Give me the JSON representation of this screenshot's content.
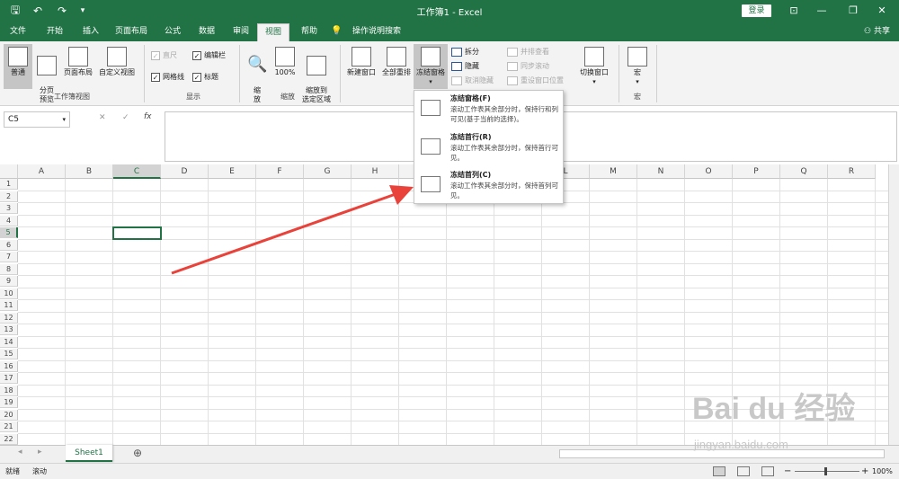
{
  "titlebar": {
    "title": "工作簿1  -  Excel",
    "login": "登录",
    "save_glyph": "🖫",
    "undo_glyph": "↶",
    "redo_glyph": "↷",
    "customize_glyph": "▾",
    "ribbon_display_glyph": "⊡",
    "minimize_glyph": "—",
    "restore_glyph": "❐",
    "close_glyph": "✕"
  },
  "tabs": [
    "文件",
    "开始",
    "插入",
    "页面布局",
    "公式",
    "数据",
    "审阅",
    "视图",
    "帮助",
    "操作说明搜索"
  ],
  "active_tab": "视图",
  "share_label": "共享",
  "ribbon": {
    "workbook_views": {
      "label": "工作簿视图",
      "normal": "普通",
      "page_break": "分页\n预览",
      "page_layout": "页面布局",
      "custom": "自定义视图"
    },
    "show": {
      "label": "显示",
      "ruler": "直尺",
      "formula_bar": "编辑栏",
      "gridlines": "网格线",
      "headings": "标题"
    },
    "zoom": {
      "label": "缩放",
      "zoom": "缩\n放",
      "hundred": "100%",
      "zoom_selection": "缩放到\n选定区域"
    },
    "window": {
      "new_window": "新建窗口",
      "arrange_all": "全部重排",
      "freeze_panes": "冻结窗格",
      "split": "拆分",
      "hide": "隐藏",
      "unhide": "取消隐藏",
      "view_side": "并排查看",
      "sync_scroll": "同步滚动",
      "reset_pos": "重设窗口位置",
      "switch": "切换窗口",
      "dropdown_glyph": "▾"
    },
    "macros": {
      "label": "宏",
      "macro": "宏"
    }
  },
  "formula_bar": {
    "name_box": "C5",
    "cancel_glyph": "✕",
    "enter_glyph": "✓",
    "fx_glyph": "fx",
    "dropdown_glyph": "▾",
    "value": ""
  },
  "grid": {
    "columns": [
      "A",
      "B",
      "C",
      "D",
      "E",
      "F",
      "G",
      "H",
      "I",
      "J",
      "K",
      "L",
      "M",
      "N",
      "O",
      "P",
      "Q",
      "R"
    ],
    "rows": [
      "1",
      "2",
      "3",
      "4",
      "5",
      "6",
      "7",
      "8",
      "9",
      "10",
      "11",
      "12",
      "13",
      "14",
      "15",
      "16",
      "17",
      "18",
      "19",
      "20",
      "21",
      "22"
    ],
    "selected_col": "C",
    "selected_row": "5"
  },
  "dropdown": {
    "items": [
      {
        "title": "冻结窗格(F)",
        "desc": "滚动工作表其余部分时，保持行和列可见(基于当前的选择)。"
      },
      {
        "title": "冻结首行(R)",
        "desc": "滚动工作表其余部分时，保持首行可见。"
      },
      {
        "title": "冻结首列(C)",
        "desc": "滚动工作表其余部分时，保持首列可见。"
      }
    ]
  },
  "sheets": {
    "active": "Sheet1",
    "add_glyph": "⊕",
    "prev_glyph": "◂",
    "next_glyph": "▸"
  },
  "status": {
    "ready": "就绪",
    "scroll": "滚动",
    "zoom_level": "100%",
    "zoom_minus": "−",
    "zoom_plus": "+"
  },
  "watermark": {
    "brand": "Bai du 经验",
    "url": "jingyan.baidu.com"
  },
  "colors": {
    "excel_green": "#217346",
    "annotation_red": "#e8423a"
  }
}
